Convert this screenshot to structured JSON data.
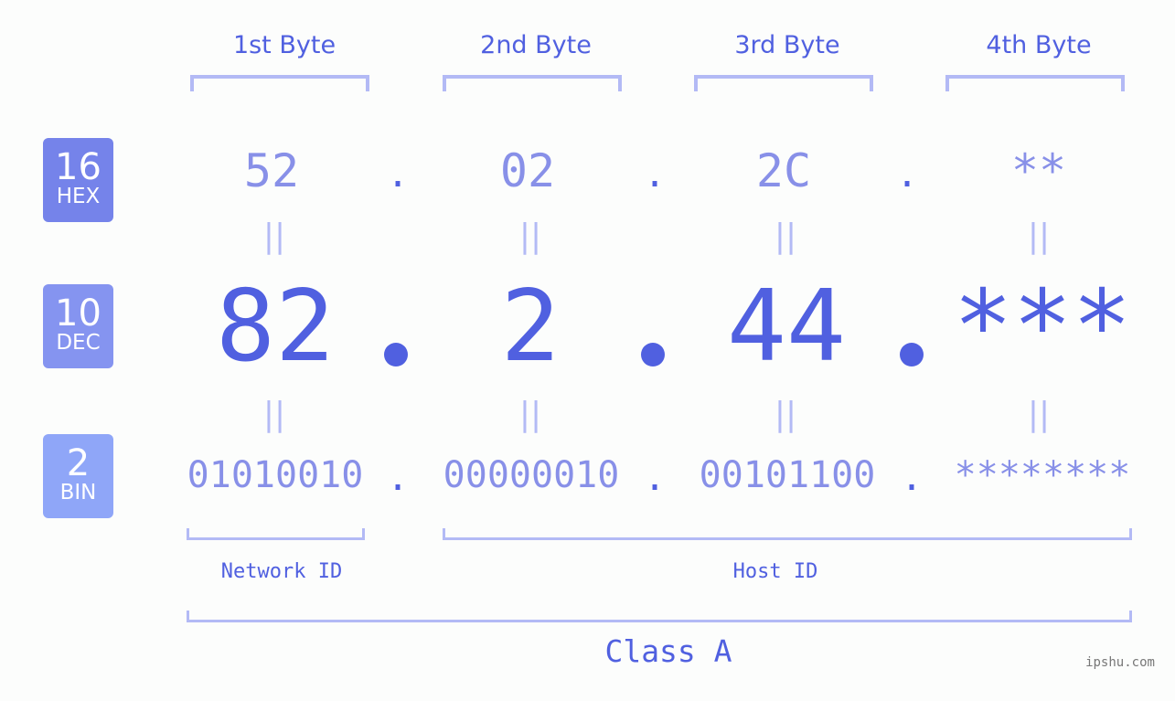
{
  "headers": [
    "1st Byte",
    "2nd Byte",
    "3rd Byte",
    "4th Byte"
  ],
  "badges": [
    {
      "number": "16",
      "label": "HEX",
      "color": "#7583ea"
    },
    {
      "number": "10",
      "label": "DEC",
      "color": "#8594f0"
    },
    {
      "number": "2",
      "label": "BIN",
      "color": "#8fa6f8"
    }
  ],
  "hex": [
    "52",
    "02",
    "2C",
    "**"
  ],
  "dec": [
    "82",
    "2",
    "44",
    "***"
  ],
  "bin": [
    "01010010",
    "00000010",
    "00101100",
    "********"
  ],
  "separator": ".",
  "equals": "=",
  "network_label": "Network ID",
  "host_label": "Host ID",
  "class_label": "Class A",
  "watermark": "ipshu.com",
  "colors": {
    "accent": "#5060e0",
    "light": "#8890e8",
    "bracket": "#b3baf5"
  }
}
